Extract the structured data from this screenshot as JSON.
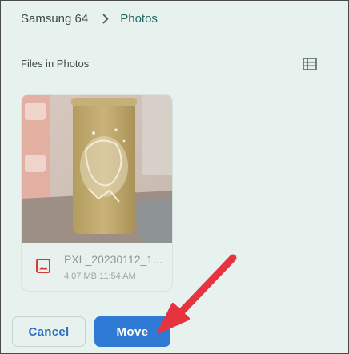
{
  "breadcrumb": {
    "root": "Samsung 64",
    "separator_icon": "chevron-right-icon",
    "current": "Photos"
  },
  "section": {
    "title": "Files in Photos",
    "view_toggle_icon": "list-view-icon"
  },
  "files": [
    {
      "name": "PXL_20230112_1...",
      "details": "4.07 MB 11:54 AM",
      "type_icon": "image-file-icon"
    }
  ],
  "actions": {
    "cancel_label": "Cancel",
    "move_label": "Move"
  },
  "colors": {
    "background": "#e7f2ef",
    "accent": "#2e7ad5",
    "breadcrumb_current": "#1f6b62",
    "image_icon": "#d33a3a",
    "annotation_arrow": "#e53440"
  }
}
